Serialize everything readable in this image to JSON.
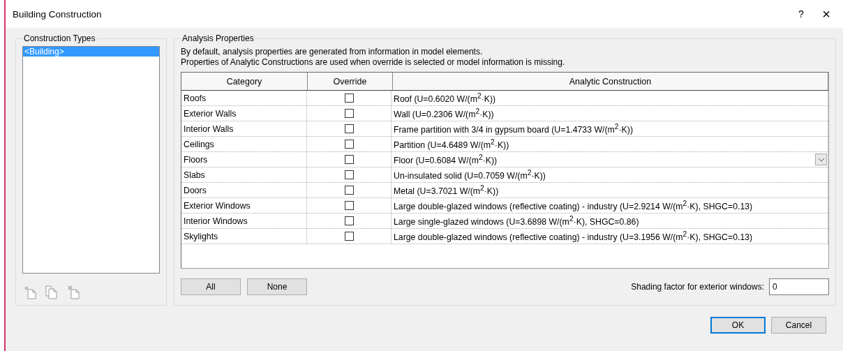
{
  "window": {
    "title": "Building Construction",
    "help": "?",
    "close": "×"
  },
  "construction_types": {
    "label": "Construction Types",
    "items": [
      {
        "label": "<Building>",
        "selected": true
      }
    ]
  },
  "analysis_properties": {
    "label": "Analysis Properties",
    "description": [
      "By default, analysis properties are generated from information in model elements.",
      "Properties of Analytic Constructions are used when override is selected or model information is missing."
    ],
    "table": {
      "columns": [
        "Category",
        "Override",
        "Analytic Construction"
      ],
      "rows": [
        {
          "category": "Roofs",
          "override": false,
          "construction": "Roof (U=0.6020 W/(m$^{2}$·K))",
          "selected": false
        },
        {
          "category": "Exterior Walls",
          "override": false,
          "construction": "Wall (U=0.2306 W/(m$^{2}$·K))",
          "selected": false
        },
        {
          "category": "Interior Walls",
          "override": false,
          "construction": "Frame partition with 3/4 in gypsum board (U=1.4733 W/(m$^{2}$·K))",
          "selected": false
        },
        {
          "category": "Ceilings",
          "override": false,
          "construction": "Partition (U=4.6489 W/(m$^{2}$·K))",
          "selected": false
        },
        {
          "category": "Floors",
          "override": false,
          "construction": "Floor (U=0.6084 W/(m$^{2}$·K))",
          "selected": true
        },
        {
          "category": "Slabs",
          "override": false,
          "construction": "Un-insulated solid (U=0.7059 W/(m$^{2}$·K))",
          "selected": false
        },
        {
          "category": "Doors",
          "override": false,
          "construction": "Metal (U=3.7021 W/(m$^{2}$·K))",
          "selected": false
        },
        {
          "category": "Exterior Windows",
          "override": false,
          "construction": "Large double-glazed windows (reflective coating) - industry (U=2.9214 W/(m$^{2}$·K), SHGC=0.13)",
          "selected": false
        },
        {
          "category": "Interior Windows",
          "override": false,
          "construction": "Large single-glazed windows (U=3.6898 W/(m$^{2}$·K), SHGC=0.86)",
          "selected": false
        },
        {
          "category": "Skylights",
          "override": false,
          "construction": "Large double-glazed windows (reflective coating) - industry (U=3.1956 W/(m$^{2}$·K), SHGC=0.13)",
          "selected": false
        }
      ]
    },
    "buttons": [
      "All",
      "None"
    ],
    "shading": {
      "label": "Shading factor for exterior windows:",
      "value": "0"
    }
  },
  "footer_buttons": [
    {
      "label": "OK",
      "default": true
    },
    {
      "label": "Cancel",
      "default": false
    }
  ]
}
